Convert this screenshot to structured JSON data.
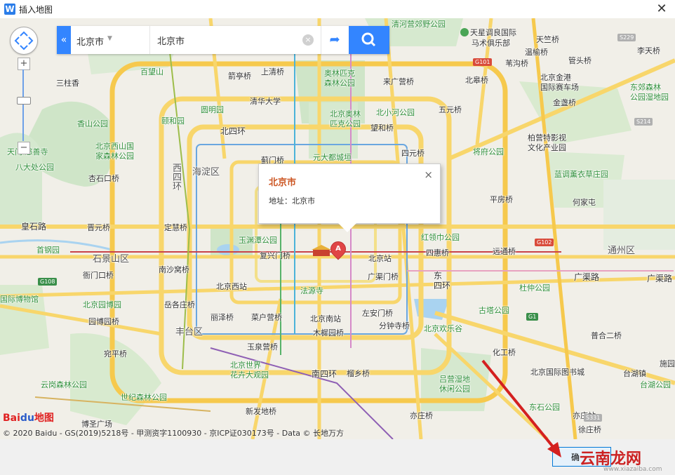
{
  "window": {
    "title": "插入地图",
    "app_icon": "W",
    "close_glyph": "✕"
  },
  "search": {
    "city": "北京市",
    "query": "北京市",
    "clear_glyph": "×",
    "collapse_glyph": "«",
    "route_glyph": "➦"
  },
  "popup": {
    "title": "北京市",
    "address": "地址：北京市",
    "close_glyph": "×"
  },
  "marker": {
    "label": "A"
  },
  "map": {
    "logo_red": "Bai",
    "logo_blue": "du",
    "logo_suffix": "地图",
    "copyright": "© 2020 Baidu - GS(2019)5218号 - 甲测资字1100930 - 京ICP证030173号 - Data © 长地万方",
    "zoom_in": "+",
    "zoom_out": "−",
    "labels": {
      "l1": "清河营郊野公园",
      "l2": "天星调良国际",
      "l3": "马术俱乐部",
      "l4": "天竺桥",
      "l5": "温榆桥",
      "l6": "李天桥",
      "l7": "百望山",
      "l8": "箭亭桥",
      "l9": "上清桥",
      "l10": "奥林匹克",
      "l11": "森林公园",
      "l12": "来广营桥",
      "l13": "苇沟桥",
      "l14": "管头桥",
      "l15": "三柱香",
      "l16": "北皋桥",
      "l17": "北京金港",
      "l18": "国际赛车场",
      "l19": "东郊森林",
      "l20": "公园湿地园",
      "l21": "清华大学",
      "l22": "圆明园",
      "l23": "颐和园",
      "l24": "北京奥林",
      "l25": "匹克公园",
      "l26": "北小河公园",
      "l27": "五元桥",
      "l28": "金盏桥",
      "l29": "香山公园",
      "l30": "北四环",
      "l31": "望和桥",
      "l32": "柏营特影视",
      "l33": "文化产业园",
      "l34": "北京西山国",
      "l35": "家森林公园",
      "l36": "天门·慈善寺",
      "l37": "蓟门桥",
      "l38": "元大都城垣",
      "l39": "四元桥",
      "l40": "将府公园",
      "l41": "八大处公园",
      "l42": "海淀区",
      "l43": "蓝调薰衣草庄园",
      "l44": "杏石口桥",
      "l45": "平房桥",
      "l46": "何家屯",
      "l47": "皇石路",
      "l48": "晋元桥",
      "l49": "定慧桥",
      "l50": "红领巾公园",
      "l51": "玉渊潭公园",
      "l52": "首钢园",
      "l53": "复兴门桥",
      "l54": "北京站",
      "l55": "四惠桥",
      "l56": "远通桥",
      "l57": "通州区",
      "l58": "石景山区",
      "l59": "衙门口桥",
      "l60": "南沙窝桥",
      "l61": "广渠门桥",
      "l62": "东",
      "l63": "四环",
      "l64": "广渠路",
      "l65": "北京西站",
      "l66": "法源寺",
      "l67": "杜仲公园",
      "l68": "国际博物馆",
      "l69": "北京园博园",
      "l70": "岳各庄桥",
      "l71": "丽泽桥",
      "l72": "菜户营桥",
      "l73": "北京南站",
      "l74": "左安门桥",
      "l75": "古塔公园",
      "l76": "园博园桥",
      "l77": "丰台区",
      "l78": "木樨园桥",
      "l79": "分钟寺桥",
      "l80": "北京欢乐谷",
      "l81": "普合二桥",
      "l82": "宛平桥",
      "l83": "玉泉营桥",
      "l84": "化工桥",
      "l85": "北京世界",
      "l86": "花卉大观园",
      "l87": "南四环",
      "l88": "榴乡桥",
      "l89": "吕营湿地",
      "l90": "休闲公园",
      "l91": "北京国际图书城",
      "l92": "台湖镇",
      "l93": "施园",
      "l94": "云岗森林公园",
      "l95": "世纪森林公园",
      "l96": "台湖公园",
      "l97": "东石公园",
      "l98": "新发地桥",
      "l99": "亦庄桥",
      "l100": "亦庄站",
      "l101": "博圣广场",
      "l102": "徐庄桥",
      "l103": "西四环"
    },
    "shields": {
      "s1": "G101",
      "s2": "G102",
      "s3": "G108",
      "s4": "G1",
      "s5": "S214",
      "s6": "S229",
      "s7": "S331"
    }
  },
  "footer": {
    "ok_label": "确",
    "watermark": "云南龙网",
    "watermark_url": "www.xiazaiba.com"
  }
}
